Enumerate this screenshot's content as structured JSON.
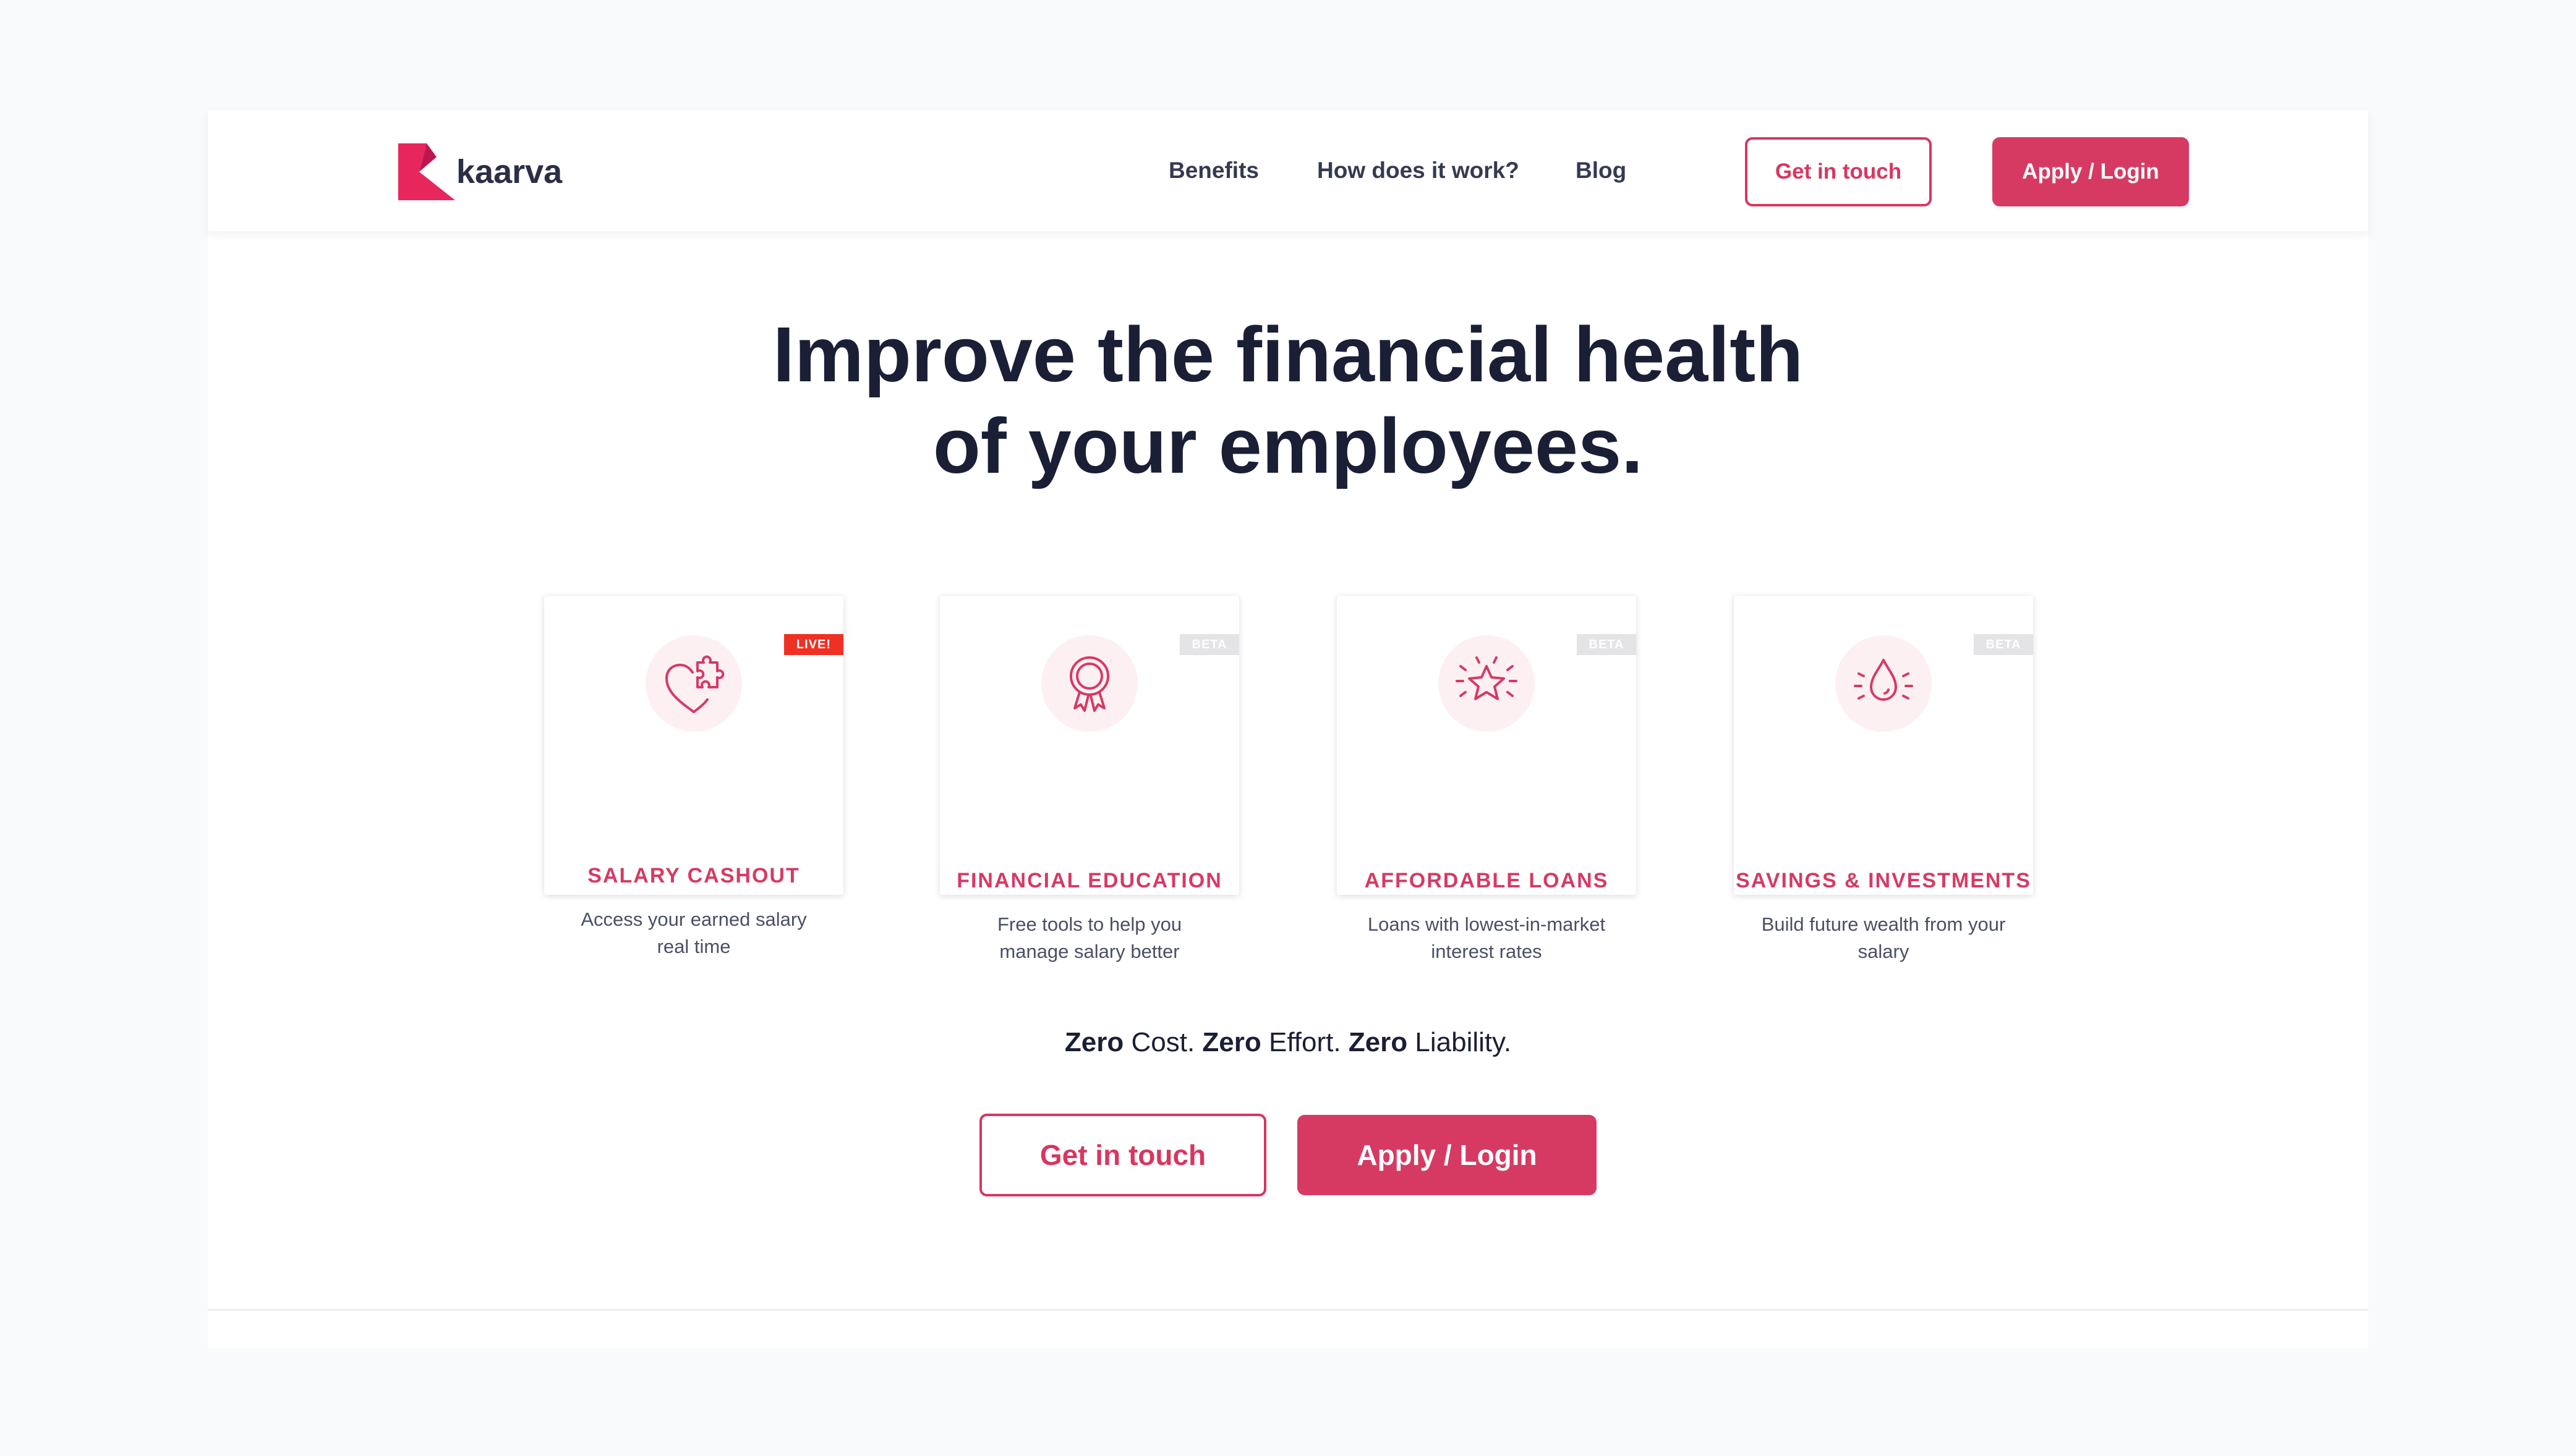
{
  "brand": {
    "name": "kaarva",
    "accent_color": "#d63a63",
    "live_color": "#ee3124"
  },
  "nav": {
    "items": [
      {
        "label": "Benefits"
      },
      {
        "label": "How does it work?"
      },
      {
        "label": "Blog"
      }
    ],
    "get_in_touch": "Get in touch",
    "apply_login": "Apply / Login"
  },
  "hero": {
    "title_line1": "Improve the financial health",
    "title_line2": "of your employees."
  },
  "cards": [
    {
      "icon": "heart-puzzle-icon",
      "badge": "LIVE!",
      "title": "SALARY CASHOUT",
      "desc": "Access your earned salary real time"
    },
    {
      "icon": "award-ribbon-icon",
      "badge": "BETA",
      "title": "FINANCIAL EDUCATION",
      "desc": "Free tools to help you manage salary better"
    },
    {
      "icon": "sparkle-star-icon",
      "badge": "BETA",
      "title": "AFFORDABLE LOANS",
      "desc": "Loans with lowest-in-market interest rates"
    },
    {
      "icon": "sparkle-drop-icon",
      "badge": "BETA",
      "title": "SAVINGS & INVESTMENTS",
      "desc": "Build future wealth from your salary"
    }
  ],
  "tagline": {
    "zero": "Zero",
    "cost": " Cost. ",
    "effort": " Effort. ",
    "liability": " Liability."
  },
  "cta": {
    "get_in_touch": "Get in touch",
    "apply_login": "Apply / Login"
  }
}
